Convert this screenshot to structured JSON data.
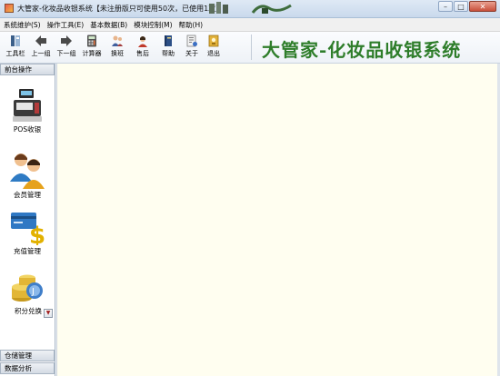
{
  "window": {
    "title": "大管家-化妆品收银系统【未注册版只可使用50次，已使用1次】",
    "controls": {
      "minimize": "–",
      "maximize": "□",
      "close": "✕"
    }
  },
  "menu": [
    "系统维护(S)",
    "操作工具(E)",
    "基本数据(B)",
    "模块控制(M)",
    "帮助(H)"
  ],
  "toolbar": {
    "buttons": [
      {
        "label": "工具栏",
        "icon": "toolbar-icon"
      },
      {
        "label": "上一组",
        "icon": "arrow-left-icon"
      },
      {
        "label": "下一组",
        "icon": "arrow-right-icon"
      },
      {
        "label": "计算器",
        "icon": "calculator-icon"
      },
      {
        "label": "换班",
        "icon": "shift-change-icon"
      },
      {
        "label": "售后",
        "icon": "after-sales-icon"
      },
      {
        "label": "帮助",
        "icon": "help-book-icon"
      },
      {
        "label": "关于",
        "icon": "about-icon"
      },
      {
        "label": "退出",
        "icon": "exit-icon"
      }
    ],
    "brand": "大管家-化妆品收银系统"
  },
  "sidebar": {
    "top_header": "前台操作",
    "items": [
      {
        "label": "POS收银",
        "icon": "cash-register-icon"
      },
      {
        "label": "会员管理",
        "icon": "members-icon"
      },
      {
        "label": "充值管理",
        "icon": "recharge-card-icon"
      },
      {
        "label": "积分兑换",
        "icon": "coins-icon"
      }
    ],
    "bottom_headers": [
      "仓储管理",
      "数据分析"
    ]
  },
  "colors": {
    "brand": "#2e7d2a",
    "workspace": "#fffef0"
  }
}
